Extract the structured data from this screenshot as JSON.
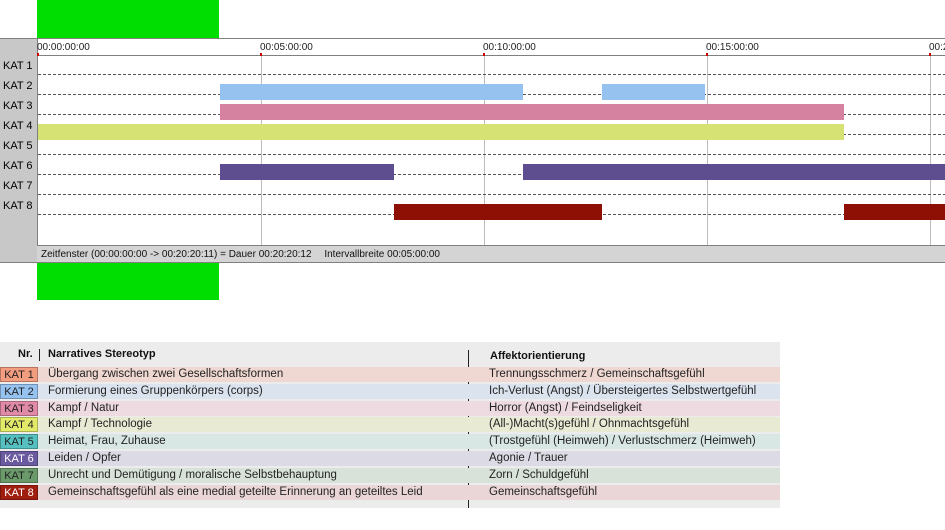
{
  "timeline": {
    "ticks": [
      {
        "label": "00:00:00:00",
        "minutes": 0
      },
      {
        "label": "00:05:00:00",
        "minutes": 5
      },
      {
        "label": "00:10:00:00",
        "minutes": 10
      },
      {
        "label": "00:15:00:00",
        "minutes": 15
      },
      {
        "label": "00:2",
        "minutes": 20
      }
    ],
    "categories": [
      "KAT 1",
      "KAT 2",
      "KAT 3",
      "KAT 4",
      "KAT 5",
      "KAT 6",
      "KAT 7",
      "KAT 8"
    ],
    "segments": [
      {
        "cat": 1,
        "start": 4.07,
        "end": 10.88,
        "color": "#96c2f0"
      },
      {
        "cat": 1,
        "start": 12.65,
        "end": 14.95,
        "color": "#96c2f0"
      },
      {
        "cat": 2,
        "start": 4.07,
        "end": 18.07,
        "color": "#d4829f"
      },
      {
        "cat": 3,
        "start": 0.0,
        "end": 18.07,
        "color": "#d6e273"
      },
      {
        "cat": 5,
        "start": 4.07,
        "end": 7.98,
        "color": "#5e4e90"
      },
      {
        "cat": 5,
        "start": 10.88,
        "end": 20.35,
        "color": "#5e4e90"
      },
      {
        "cat": 7,
        "start": 7.98,
        "end": 12.65,
        "color": "#8e1005"
      },
      {
        "cat": 7,
        "start": 18.07,
        "end": 20.35,
        "color": "#8e1005"
      }
    ],
    "status_window": "Zeitfenster (00:00:00:00 -> 00:20:20:11) = Dauer 00:20:20:12",
    "status_interval": "Intervallbreite 00:05:00:00"
  },
  "legend": {
    "header_nr": "Nr.",
    "header_narrative": "Narratives Stereotyp",
    "header_affect": "Affektorientierung",
    "rows": [
      {
        "key": "KAT 1",
        "narrative": "Übergang zwischen zwei Gesellschaftsformen",
        "affect": "Trennungsschmerz / Gemeinschaftsgefühl",
        "key_color": "#f29c80",
        "row_color": "#f0d8d2"
      },
      {
        "key": "KAT 2",
        "narrative": "Formierung eines Gruppenkörpers (corps)",
        "affect": "Ich-Verlust (Angst) / Übersteigertes Selbstwertgefühl",
        "key_color": "#96c2f0",
        "row_color": "#dbe3ee"
      },
      {
        "key": "KAT 3",
        "narrative": "Kampf / Natur",
        "affect": "Horror (Angst) / Feindseligkeit",
        "key_color": "#e08aa8",
        "row_color": "#eedbe1"
      },
      {
        "key": "KAT 4",
        "narrative": "Kampf / Technologie",
        "affect": "(All-)Macht(s)gefühl / Ohnmachtsgefühl",
        "key_color": "#e3ea6a",
        "row_color": "#e8ead4"
      },
      {
        "key": "KAT 5",
        "narrative": "Heimat, Frau, Zuhause",
        "affect": "(Trostgefühl (Heimweh) / Verlustschmerz (Heimweh)",
        "key_color": "#56c0c0",
        "row_color": "#d8e6e4"
      },
      {
        "key": "KAT 6",
        "narrative": "Leiden / Opfer",
        "affect": "Agonie / Trauer",
        "key_color": "#6a5aa0",
        "row_color": "#dcdae4"
      },
      {
        "key": "KAT 7",
        "narrative": "Unrecht und Demütigung / moralische Selbstbehauptung",
        "affect": "Zorn / Schuldgefühl",
        "key_color": "#6a9a6a",
        "row_color": "#d9e2d9"
      },
      {
        "key": "KAT 8",
        "narrative": "Gemeinschaftsgefühl als eine medial geteilte Erinnerung an geteiltes Leid",
        "affect": "Gemeinschaftsgefühl",
        "key_color": "#a01e10",
        "row_color": "#ead6d6"
      }
    ]
  },
  "colors": {
    "green_block": "#00dd00",
    "key_text_light": "#ffffff"
  }
}
